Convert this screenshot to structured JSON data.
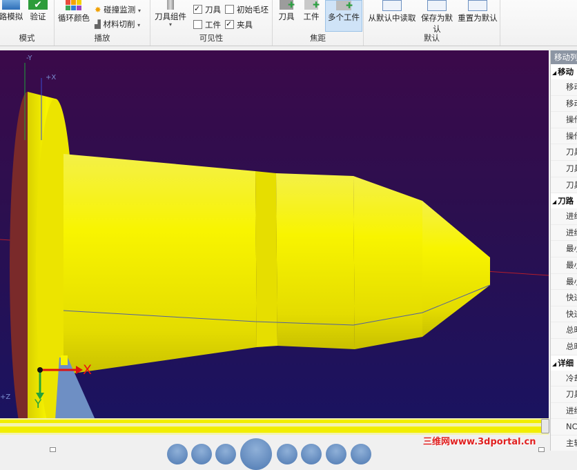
{
  "ribbon": {
    "mode": {
      "label": "模式",
      "btn_sim": "路模拟",
      "btn_verify": "验证"
    },
    "playback": {
      "label": "播放",
      "cycle_color": "循环颜色",
      "collision_check": "碰撞监测",
      "material_cut": "材料切削"
    },
    "visibility": {
      "label": "可见性",
      "tool_assembly": "刀具组件",
      "cb_tool": "刀具",
      "cb_initial_blank": "初始毛坯",
      "cb_workpiece": "工件",
      "cb_fixture": "夹具",
      "checked": {
        "tool": true,
        "initial_blank": false,
        "workpiece": false,
        "fixture": true
      }
    },
    "focus": {
      "label": "焦距",
      "tool": "刀具",
      "workpiece": "工件",
      "multi_workpiece": "多个工件"
    },
    "defaults": {
      "label": "默认",
      "read_default": "从默认中读取",
      "save_default": "保存为默认",
      "reset_default": "重置为默认"
    }
  },
  "viewport": {
    "axes": {
      "x": "X",
      "y": "Y",
      "y_top": "-Y",
      "z_left": "+Z",
      "x_top": "+X"
    }
  },
  "panel": {
    "title": "移动列表",
    "sections": [
      {
        "title": "移动",
        "items": [
          "移动",
          "移动",
          "操作",
          "操作",
          "刀具",
          "刀具",
          "刀具"
        ]
      },
      {
        "title": "刀路",
        "items": [
          "进给",
          "进给",
          "最小",
          "最小",
          "最小",
          "快进",
          "快进",
          "总时",
          "总时"
        ]
      },
      {
        "title": "详细",
        "items": [
          "冷却",
          "刀具",
          "进给",
          "NC",
          "主轴"
        ]
      }
    ]
  },
  "watermark": "三维网www.3dportal.cn",
  "colors": {
    "part": "#f2ee00",
    "viewport_top": "#3b0a4a",
    "viewport_bottom": "#1a1360",
    "accent": "#2a7ad5"
  }
}
